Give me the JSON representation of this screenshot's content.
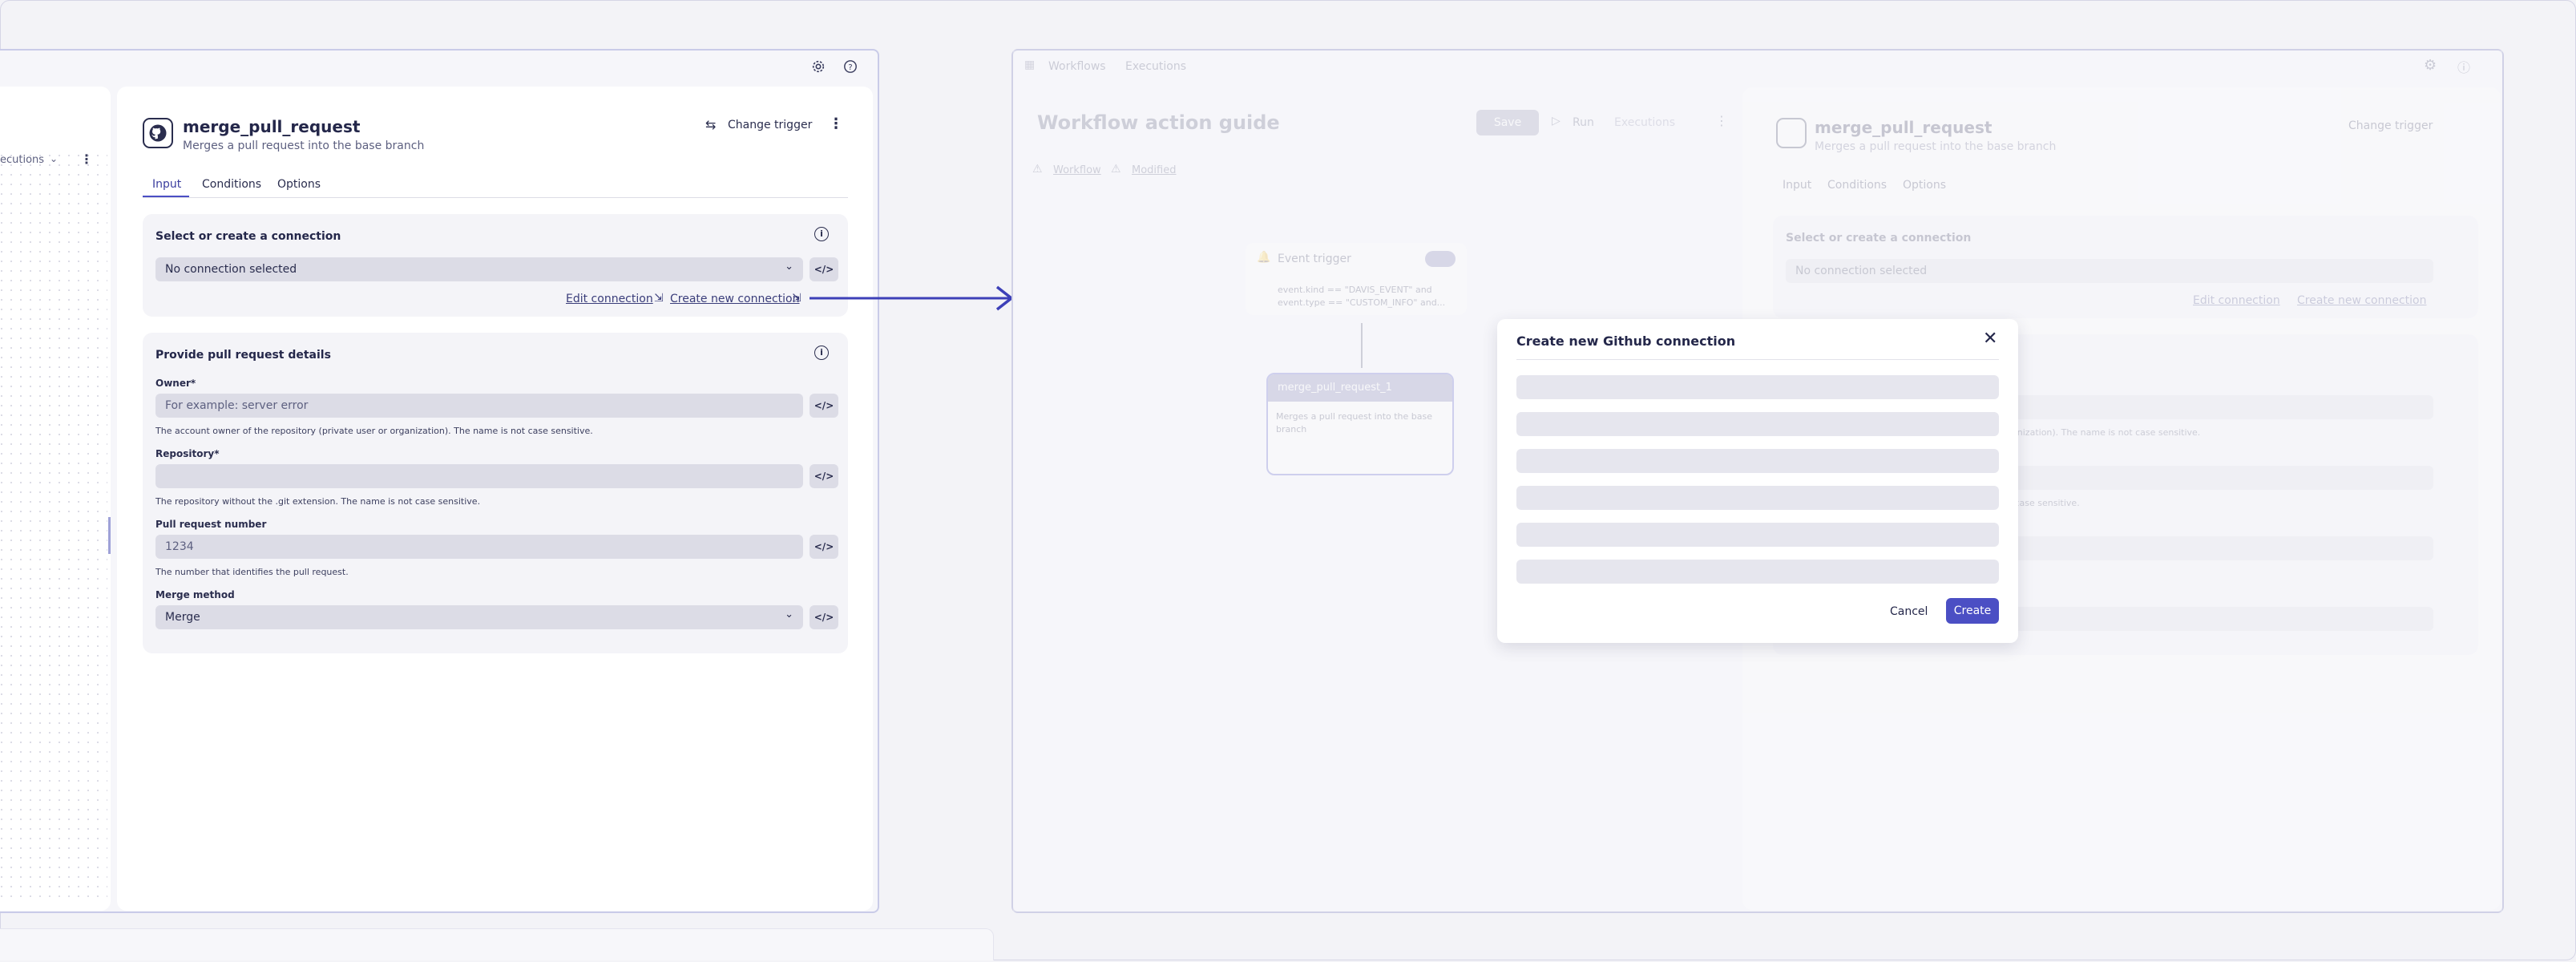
{
  "left_panel": {
    "executions_tab_partial": "ecutions",
    "action_title": "merge_pull_request",
    "action_subtitle": "Merges a pull request into the base branch",
    "change_trigger_label": "Change trigger",
    "tabs": [
      {
        "label": "Input",
        "active": true
      },
      {
        "label": "Conditions",
        "active": false
      },
      {
        "label": "Options",
        "active": false
      }
    ],
    "connection_section": {
      "title": "Select or create a connection",
      "select_value": "No connection selected",
      "edit_link": "Edit connection",
      "create_link": "Create new connection"
    },
    "details_section": {
      "title": "Provide pull request details",
      "fields": [
        {
          "label": "Owner*",
          "placeholder": "For example: server error",
          "help": "The account owner of the repository (private user or organization). The name is not case sensitive."
        },
        {
          "label": "Repository*",
          "placeholder": "",
          "help": "The repository without the .git extension. The name is not case sensitive."
        },
        {
          "label": "Pull request number",
          "placeholder": "1234",
          "help": "The number that identifies the pull request."
        }
      ],
      "merge_method": {
        "label": "Merge method",
        "value": "Merge"
      }
    }
  },
  "right_window": {
    "nav": {
      "workflows": "Workflows",
      "executions": "Executions"
    },
    "workflow_title": "Workflow action guide",
    "toolbar": {
      "save": "Save",
      "run": "Run",
      "executions": "Executions"
    },
    "breadcrumb": {
      "workflow": "Workflow",
      "modified": "Modified"
    },
    "trigger_node": {
      "title": "Event trigger",
      "line1": "event.kind == \"DAVIS_EVENT\" and",
      "line2": "event.type == \"CUSTOM_INFO\" and..."
    },
    "action_node": {
      "title": "merge_pull_request_1",
      "desc_line1": "Merges a pull request into the base",
      "desc_line2": "branch"
    },
    "side": {
      "title": "merge_pull_request",
      "subtitle": "Merges a pull request into the base branch",
      "change_trigger": "Change trigger",
      "tabs": [
        "Input",
        "Conditions",
        "Options"
      ],
      "connection_title": "Select or create a connection",
      "select_value": "No connection selected",
      "edit_link": "Edit connection",
      "create_link": "Create new connection",
      "help_owner_partial": "organization). The name is not case sensitive.",
      "help_repo_partial": "not case sensitive."
    }
  },
  "modal": {
    "title": "Create new Github connection",
    "cancel": "Cancel",
    "create": "Create",
    "skeleton_rows": 6
  },
  "colors": {
    "accent": "#4b4fc4",
    "arrow": "#3d40b8"
  }
}
